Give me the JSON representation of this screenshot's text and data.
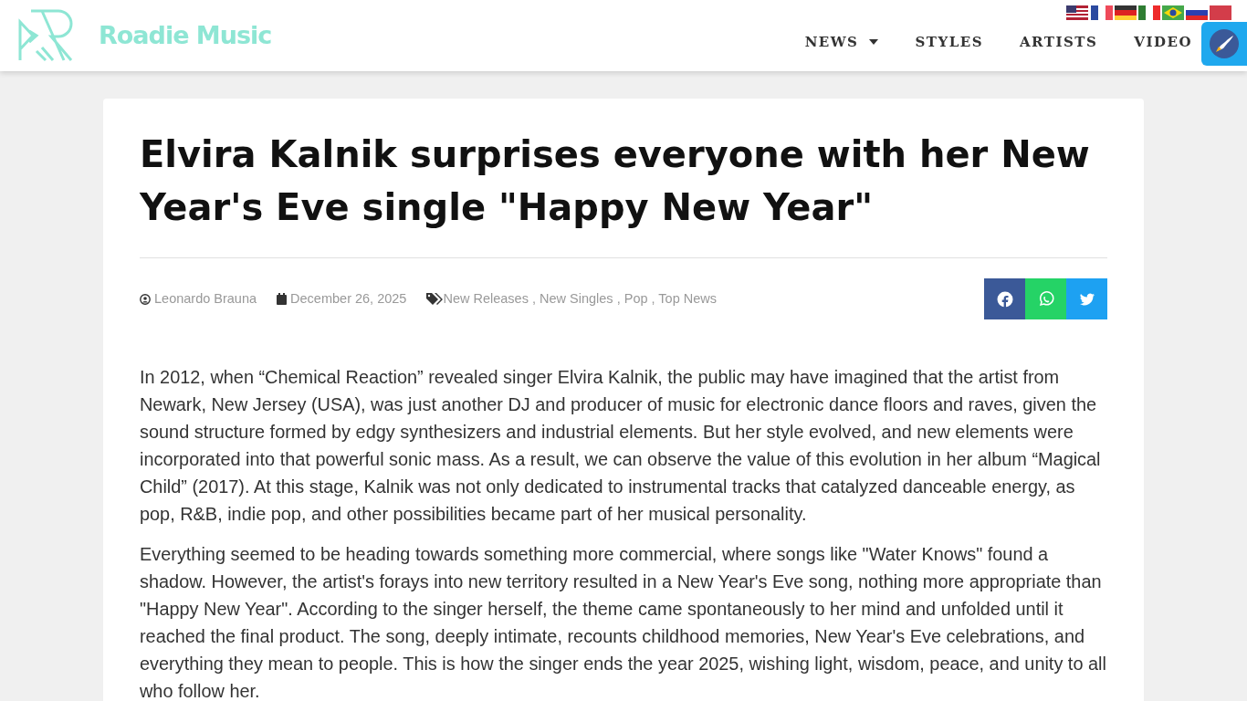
{
  "brand": {
    "name": "Roadie Music"
  },
  "nav": [
    {
      "label": "NEWS",
      "dropdown": true
    },
    {
      "label": "STYLES",
      "dropdown": false
    },
    {
      "label": "ARTISTS",
      "dropdown": false
    },
    {
      "label": "VIDEO",
      "dropdown": false
    }
  ],
  "article": {
    "title": "Elvira Kalnik surprises everyone with her New Year's Eve single \"Happy New Year\"",
    "author": "Leonardo Brauna",
    "date": "December 26, 2025",
    "tags": [
      "New Releases",
      "New Singles",
      "Pop",
      "Top News"
    ],
    "tag_separator": ",",
    "share": [
      {
        "kind": "facebook"
      },
      {
        "kind": "whatsapp"
      },
      {
        "kind": "twitter"
      }
    ],
    "paragraphs": [
      "In 2012, when “Chemical Reaction” revealed singer Elvira Kalnik, the public may have imagined that the artist from Newark, New Jersey (USA), was just another DJ and producer of music for electronic dance floors and raves, given the sound structure formed by edgy synthesizers and industrial elements. But her style evolved, and new elements were incorporated into that powerful sonic mass. As a result, we can observe the value of this evolution in her album “Magical Child” (2017). At this stage, Kalnik was not only dedicated to instrumental tracks that catalyzed danceable energy, as pop, R&B, indie pop, and other possibilities became part of her musical personality.",
      "Everything seemed to be heading towards something more commercial, where songs like \"Water Knows\" found a shadow. However, the artist's forays into new territory resulted in a New Year's Eve song, nothing more appropriate than \"Happy New Year\". According to the singer herself, the theme came spontaneously to her mind and unfolded until it reached the final product. The song, deeply intimate, recounts childhood memories, New Year's Eve celebrations, and everything they mean to people. This is how the singer ends the year 2025, wishing light, wisdom, peace, and unity to all who follow her."
    ]
  }
}
